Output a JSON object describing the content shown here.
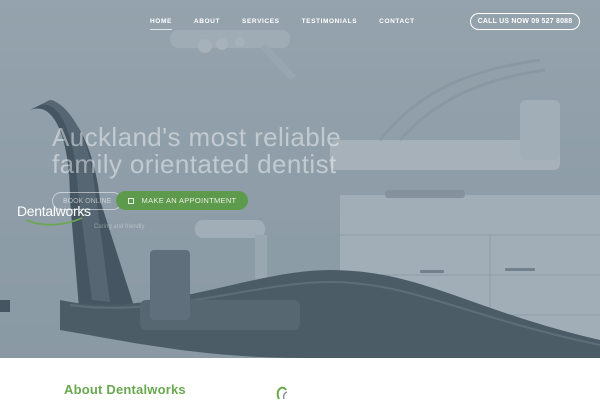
{
  "nav": {
    "items": [
      {
        "label": "HOME",
        "active": true
      },
      {
        "label": "ABOUT",
        "active": false
      },
      {
        "label": "SERVICES",
        "active": false
      },
      {
        "label": "TESTIMONIALS",
        "active": false
      },
      {
        "label": "CONTACT",
        "active": false
      }
    ],
    "call_label": "CALL US NOW 09 527 8088"
  },
  "hero": {
    "headline_line1": "Auckland's most reliable",
    "headline_line2": "family orientated dentist",
    "book_label": "BOOK ONLINE",
    "appointment_label": "MAKE AN APPOINTMENT",
    "appointment_icon": "calendar-icon",
    "overlay_color": "#3a5262"
  },
  "logo": {
    "text": "Dentalworks",
    "tagline": "Caring and friendly",
    "swoosh_color": "#6aa84f"
  },
  "about": {
    "title": "About Dentalworks",
    "icon": "tooth-icon"
  },
  "colors": {
    "accent_green": "#6aa84f",
    "button_green": "#5e9a4c"
  }
}
